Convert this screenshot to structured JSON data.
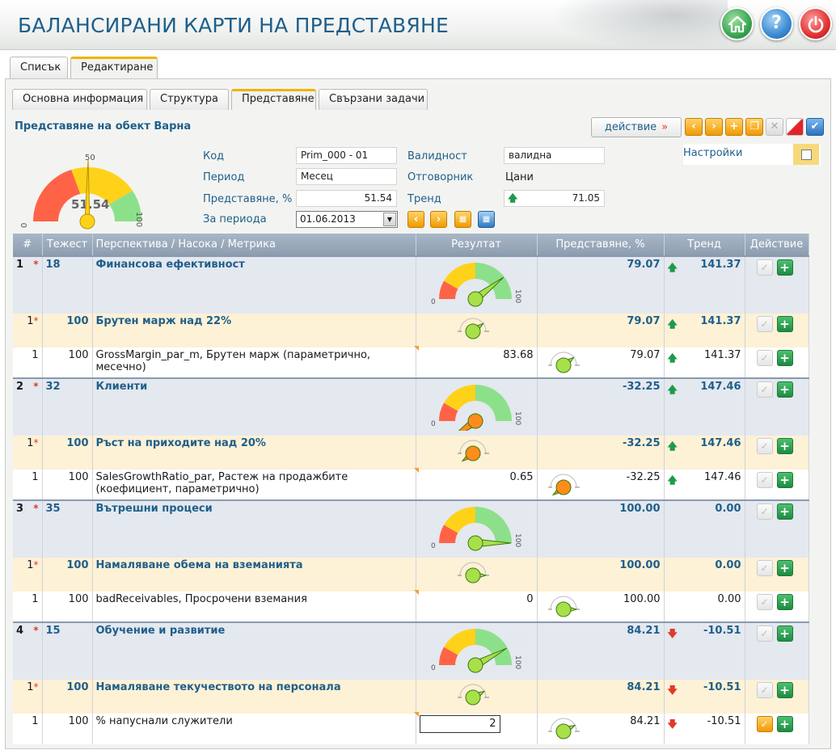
{
  "app": {
    "title": "БАЛАНСИРАНИ КАРТИ НА ПРЕДСТАВЯНЕ"
  },
  "header_buttons": [
    {
      "icon": "home-icon"
    },
    {
      "icon": "help-icon",
      "label": "?"
    },
    {
      "icon": "power-icon"
    }
  ],
  "main_tabs": [
    {
      "label": "Списък",
      "active": false
    },
    {
      "label": "Редактиране",
      "active": true
    }
  ],
  "sub_tabs": [
    {
      "label": "Основна информация",
      "active": false
    },
    {
      "label": "Структура",
      "active": false
    },
    {
      "label": "Представяне",
      "active": true
    },
    {
      "label": "Свързани задачи",
      "active": false
    }
  ],
  "section_title": "Представяне на обект Варна",
  "toolbar": {
    "action_label": "действие",
    "action_arrow": "»"
  },
  "gauge_main": {
    "value": 51.54,
    "value_text": "51.54",
    "min_label": "0",
    "max_label": "100",
    "mid_label": "50"
  },
  "form": {
    "code_label": "Код",
    "code_value": "Prim_000 - 01",
    "period_label": "Период",
    "period_value": "Месец",
    "perf_label": "Представяне, %",
    "perf_value": "51.54",
    "for_period_label": "За периода",
    "for_period_value": "01.06.2013",
    "validity_label": "Валидност",
    "validity_value": "валидна",
    "responsible_label": "Отговорник",
    "responsible_value": "Цани",
    "trend_label": "Тренд",
    "trend_value": "71.05"
  },
  "settings": {
    "label": "Настройки",
    "checked": false
  },
  "table": {
    "headers": [
      "#",
      "Тежест",
      "Перспектива / Насока / Метрика",
      "Резултат",
      "Представяне, %",
      "Тренд",
      "Действие"
    ],
    "rows": [
      {
        "level": 1,
        "num": "1",
        "weight": "18",
        "name": "Финансова ефективност",
        "result": "",
        "perf": "79.07",
        "trend_dir": "up",
        "trend": "141.37",
        "gauge": 79.07,
        "checked": false
      },
      {
        "level": 2,
        "num": "1",
        "weight": "100",
        "name": "Брутен марж над 22%",
        "result": "",
        "perf": "79.07",
        "trend_dir": "up",
        "trend": "141.37",
        "gauge": 79.07,
        "checked": false
      },
      {
        "level": 3,
        "num": "1",
        "weight": "100",
        "name": "GrossMargin_par_m, Брутен марж (параметрично, месечно)",
        "result": "83.68",
        "perf": "79.07",
        "trend_dir": "up",
        "trend": "141.37",
        "gauge": 79.07,
        "checked": false
      },
      {
        "level": 1,
        "num": "2",
        "weight": "32",
        "name": "Клиенти",
        "result": "",
        "perf": "-32.25",
        "trend_dir": "up",
        "trend": "147.46",
        "gauge": -32.25,
        "checked": false
      },
      {
        "level": 2,
        "num": "1",
        "weight": "100",
        "name": "Ръст на приходите над 20%",
        "result": "",
        "perf": "-32.25",
        "trend_dir": "up",
        "trend": "147.46",
        "gauge": -32.25,
        "checked": false
      },
      {
        "level": 3,
        "num": "1",
        "weight": "100",
        "name": "SalesGrowthRatio_par, Растеж на продажбите (коефициент, параметрично)",
        "result": "0.65",
        "perf": "-32.25",
        "trend_dir": "up",
        "trend": "147.46",
        "gauge": -32.25,
        "checked": false
      },
      {
        "level": 1,
        "num": "3",
        "weight": "35",
        "name": "Вътрешни процеси",
        "result": "",
        "perf": "100.00",
        "trend_dir": "",
        "trend": "0.00",
        "gauge": 100,
        "checked": false
      },
      {
        "level": 2,
        "num": "1",
        "weight": "100",
        "name": "Намаляване обема на вземанията",
        "result": "",
        "perf": "100.00",
        "trend_dir": "",
        "trend": "0.00",
        "gauge": 100,
        "checked": false
      },
      {
        "level": 3,
        "num": "1",
        "weight": "100",
        "name": "badReceivables, Просрочени вземания",
        "result": "0",
        "perf": "100.00",
        "trend_dir": "",
        "trend": "0.00",
        "gauge": 100,
        "checked": false
      },
      {
        "level": 1,
        "num": "4",
        "weight": "15",
        "name": "Обучение и развитие",
        "result": "",
        "perf": "84.21",
        "trend_dir": "down",
        "trend": "-10.51",
        "gauge": 84.21,
        "checked": false
      },
      {
        "level": 2,
        "num": "1",
        "weight": "100",
        "name": "Намаляване текучеството на персонала",
        "result": "",
        "perf": "84.21",
        "trend_dir": "down",
        "trend": "-10.51",
        "gauge": 84.21,
        "checked": false
      },
      {
        "level": 3,
        "num": "1",
        "weight": "100",
        "name": "% напуснали служители",
        "result": "2",
        "result_input": true,
        "perf": "84.21",
        "trend_dir": "down",
        "trend": "-10.51",
        "gauge": 84.21,
        "checked": true
      }
    ]
  },
  "gauge_scale": {
    "min_label": "0",
    "max_label": "100"
  },
  "colors": {
    "brand_blue": "#1f5f8b",
    "red": "#ff6347",
    "yellow": "#ffd21a",
    "green": "#8de08a",
    "needle_green": "#a8e04a",
    "needle_orange": "#ff8c1a"
  }
}
